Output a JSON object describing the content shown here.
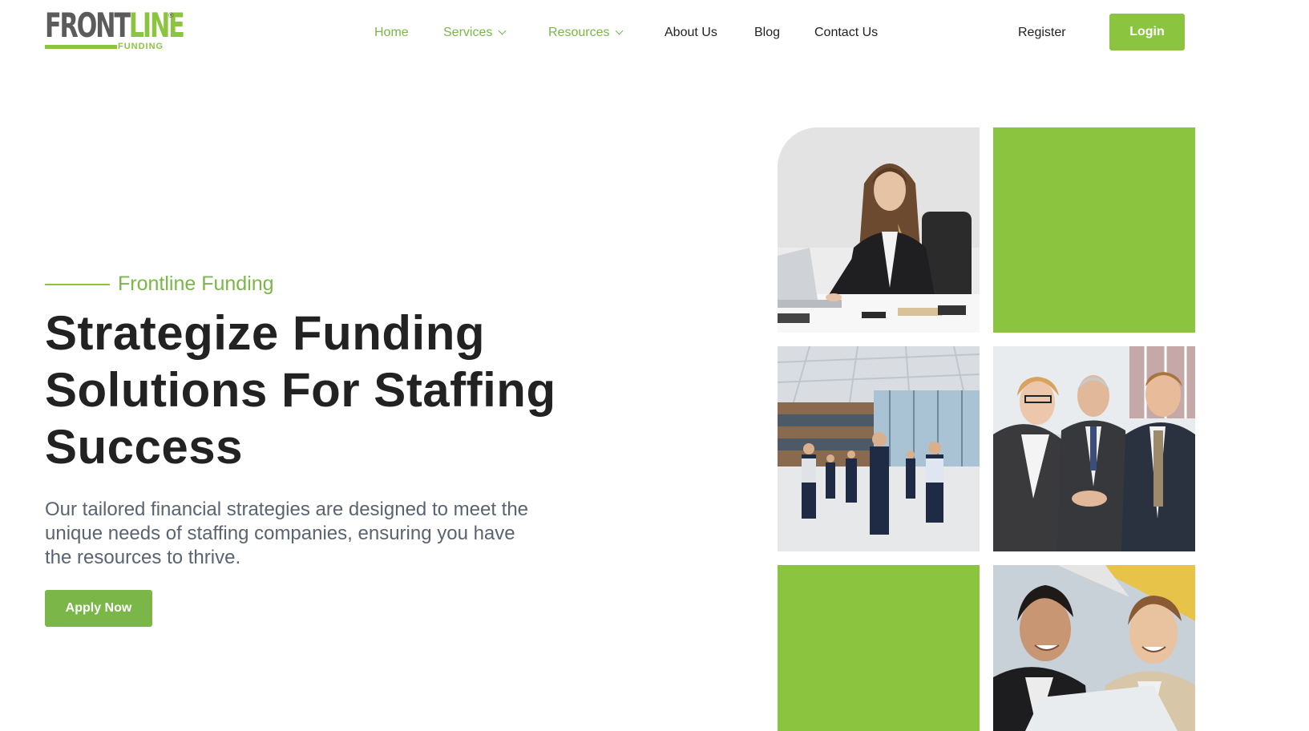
{
  "brand": {
    "logo_main_a": "FRONT",
    "logo_main_b": "LINE",
    "logo_sub": "FUNDING",
    "logo_reg": "®",
    "accent_color": "#8bc43f",
    "text_color": "#222222"
  },
  "nav": {
    "items": [
      {
        "label": "Home",
        "active": true,
        "has_dropdown": false
      },
      {
        "label": "Services",
        "active": true,
        "has_dropdown": true
      },
      {
        "label": "Resources",
        "active": true,
        "has_dropdown": true
      },
      {
        "label": "About Us",
        "active": false,
        "has_dropdown": false
      },
      {
        "label": "Blog",
        "active": false,
        "has_dropdown": false
      },
      {
        "label": "Contact Us",
        "active": false,
        "has_dropdown": false
      }
    ],
    "register_label": "Register",
    "login_label": "Login",
    "dropdown_icon": "chevron-down-icon"
  },
  "hero": {
    "eyebrow": "Frontline Funding",
    "headline_line1": "Strategize Funding",
    "headline_line2": "Solutions For Staffing",
    "headline_line3": "Success",
    "subtext_line1": "Our tailored financial strategies are designed to meet the",
    "subtext_line2": "unique needs of staffing companies, ensuring you have",
    "subtext_line3": "the resources to thrive.",
    "cta_label": "Apply Now"
  },
  "gallery": {
    "tiles": [
      {
        "kind": "photo",
        "subject": "businesswoman-at-desk-photo"
      },
      {
        "kind": "color",
        "color": "#8bc43f"
      },
      {
        "kind": "photo",
        "subject": "team-in-front-of-office-building-photo"
      },
      {
        "kind": "photo",
        "subject": "business-handshake-photo"
      },
      {
        "kind": "color",
        "color": "#8bc43f"
      },
      {
        "kind": "photo",
        "subject": "two-men-laughing-at-laptop-photo"
      }
    ]
  }
}
